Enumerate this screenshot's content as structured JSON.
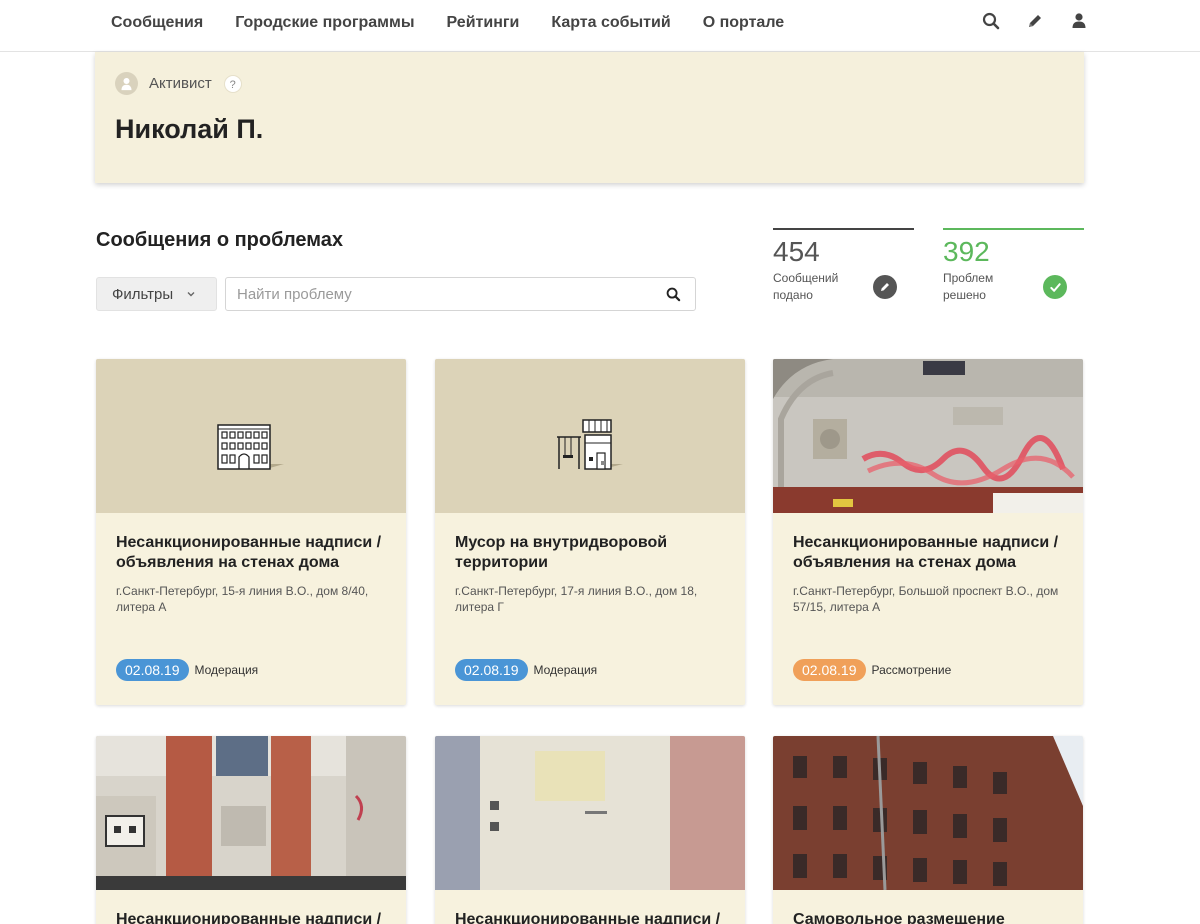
{
  "nav": {
    "items": [
      "Сообщения",
      "Городские программы",
      "Рейтинги",
      "Карта событий",
      "О портале"
    ],
    "icons": [
      "search-icon",
      "pencil-icon",
      "user-icon"
    ]
  },
  "profile": {
    "role": "Активист",
    "help": "?",
    "name": "Николай П."
  },
  "section": {
    "title": "Сообщения о проблемах",
    "filters_label": "Фильтры",
    "search_placeholder": "Найти проблему"
  },
  "stats": [
    {
      "value": "454",
      "label": "Сообщений подано",
      "color": "#555555",
      "icon": "pencil-icon"
    },
    {
      "value": "392",
      "label": "Проблем решено",
      "color": "#5cb85c",
      "icon": "check-icon"
    }
  ],
  "colors": {
    "moderation": "#4a95d6",
    "review": "#f0a059",
    "card_bg": "#f7f2de",
    "profile_bg": "#f5f0dc"
  },
  "cards": [
    {
      "title": "Несанкционированные надписи / объявления на стенах дома",
      "address": "г.Санкт-Петербург, 15-я линия В.О., дом 8/40, литера А",
      "date": "02.08.19",
      "status": "Модерация",
      "image": "building-illustration"
    },
    {
      "title": "Мусор на внутридворовой территории",
      "address": "г.Санкт-Петербург, 17-я линия В.О., дом 18, литера Г",
      "date": "02.08.19",
      "status": "Модерация",
      "image": "yard-illustration"
    },
    {
      "title": "Несанкционированные надписи / объявления на стенах дома",
      "address": "г.Санкт-Петербург, Большой проспект В.О., дом 57/15, литера А",
      "date": "02.08.19",
      "status": "Рассмотрение",
      "image": "photo-graffiti-wall"
    },
    {
      "title": "Несанкционированные надписи /",
      "image": "photo-brick-wall"
    },
    {
      "title": "Несанкционированные надписи /",
      "image": "photo-painted-wall"
    },
    {
      "title": "Самовольное размещение",
      "image": "photo-facade"
    }
  ]
}
